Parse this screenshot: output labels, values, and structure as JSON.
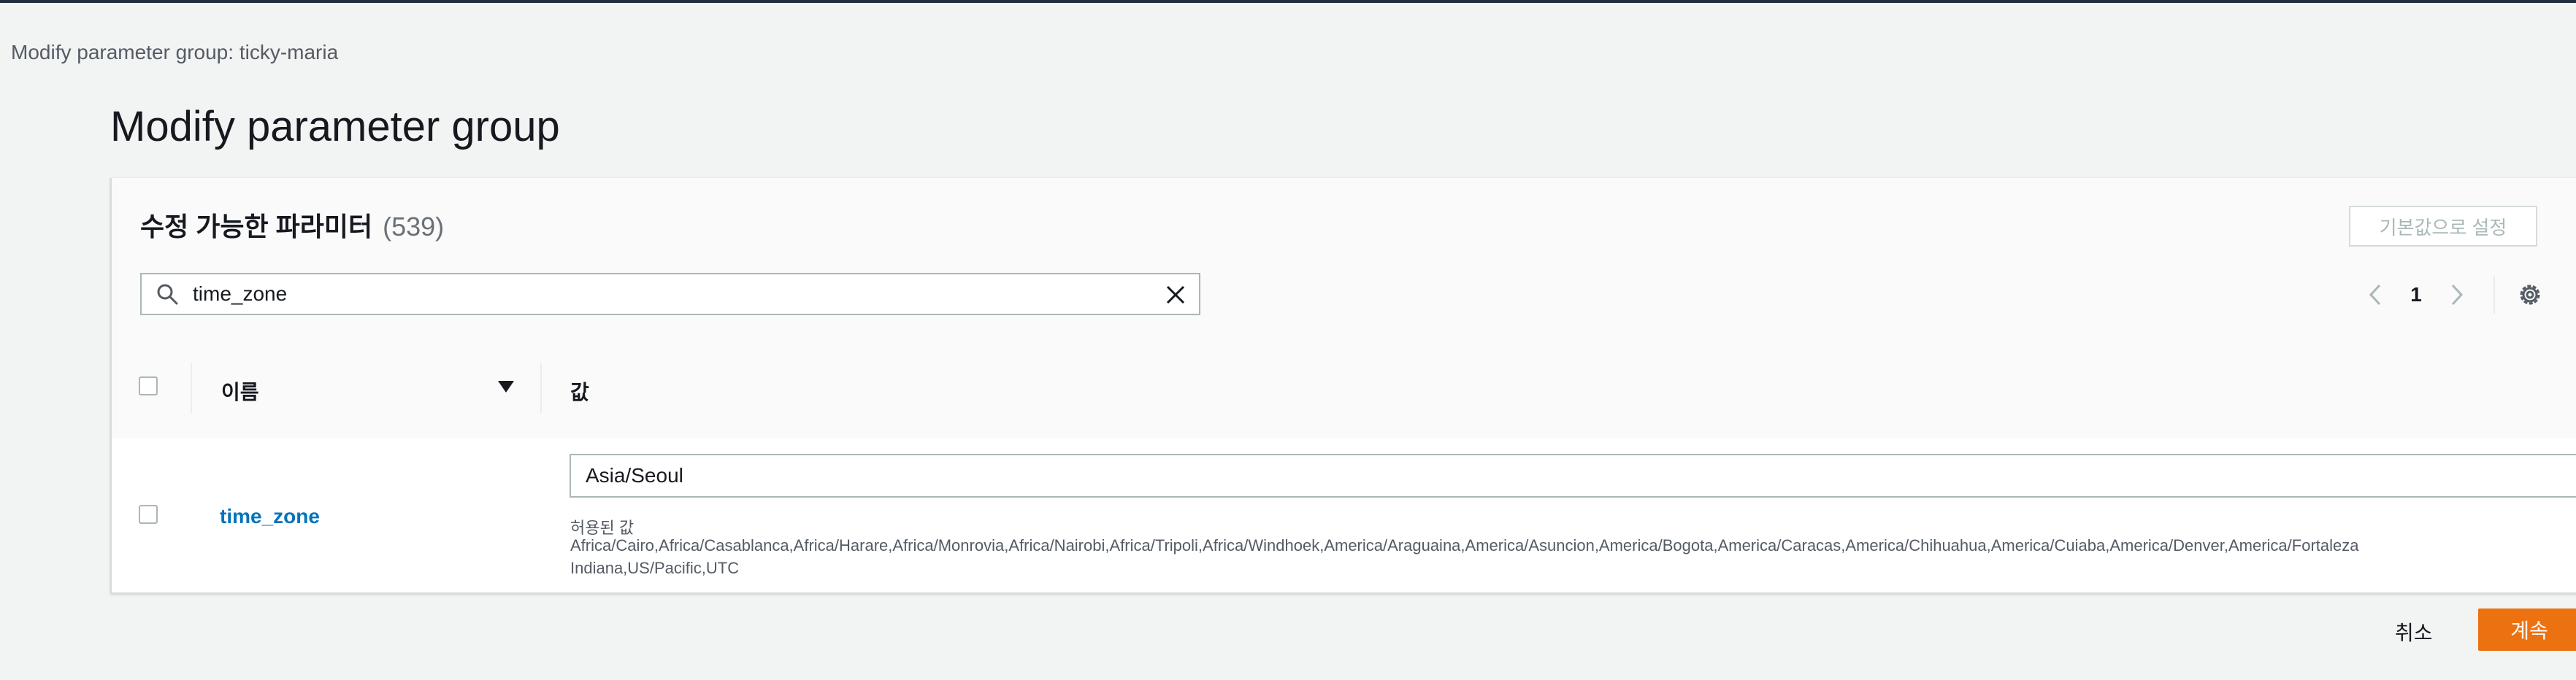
{
  "breadcrumb": "Modify parameter group: ticky-maria",
  "page_title": "Modify parameter group",
  "panel": {
    "title": "수정 가능한 파라미터",
    "count": "(539)",
    "defaults_button": "기본값으로 설정"
  },
  "search": {
    "value": "time_zone"
  },
  "pagination": {
    "current_page": "1"
  },
  "table": {
    "columns": {
      "name": "이름",
      "value": "값"
    },
    "rows": [
      {
        "name": "time_zone",
        "value": "Asia/Seoul",
        "allowed_label": "허용된 값",
        "allowed_values": "Africa/Cairo,Africa/Casablanca,Africa/Harare,Africa/Monrovia,Africa/Nairobi,Africa/Tripoli,Africa/Windhoek,America/Araguaina,America/Asuncion,America/Bogota,America/Caracas,America/Chihuahua,America/Cuiaba,America/Denver,America/Fortaleza\nIndiana,US/Pacific,UTC"
      }
    ]
  },
  "footer": {
    "cancel_label": "취소",
    "continue_label": "계속"
  },
  "colors": {
    "accent": "#ec7211",
    "link": "#0073bb",
    "topbar": "#232f3e"
  },
  "icons": {
    "search": "search-icon",
    "clear": "close-icon",
    "prev": "chevron-left-icon",
    "next": "chevron-right-icon",
    "settings": "gear-icon",
    "sort": "caret-down-icon"
  }
}
